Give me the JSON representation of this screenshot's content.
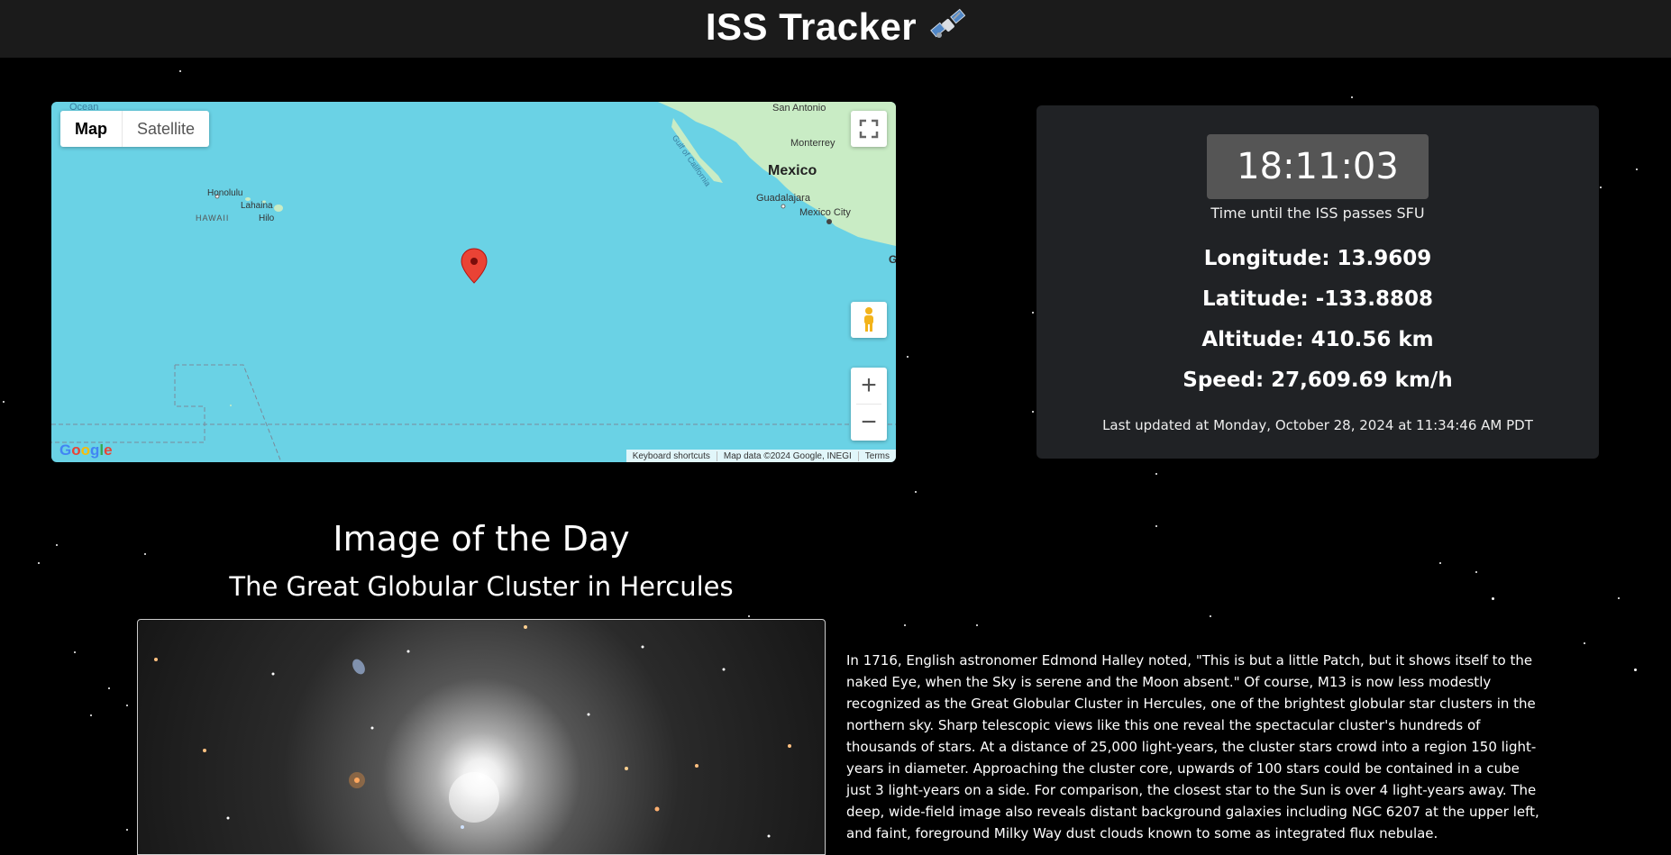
{
  "header": {
    "title": "ISS Tracker",
    "icon": "satellite-icon"
  },
  "map": {
    "type_control": {
      "map_label": "Map",
      "satellite_label": "Satellite",
      "selected": "Map"
    },
    "labels": {
      "ocean": "Ocean",
      "honolulu": "Honolulu",
      "lahaina": "Lahaina",
      "hawaii": "HAWAII",
      "hilo": "Hilo",
      "san_antonio": "San Antonio",
      "gulf": "Gulf of California",
      "monterrey": "Monterrey",
      "mexico": "Mexico",
      "guadalajara": "Guadalajara",
      "mexico_city": "Mexico City",
      "edge_g": "G"
    },
    "attribution": {
      "shortcuts": "Keyboard shortcuts",
      "data": "Map data ©2024 Google, INEGI",
      "terms": "Terms"
    },
    "logo": "Google"
  },
  "iss": {
    "countdown": "18:11:03",
    "countdown_caption": "Time until the ISS passes SFU",
    "longitude": "Longitude: 13.9609",
    "latitude": "Latitude: -133.8808",
    "altitude": "Altitude: 410.56 km",
    "speed": "Speed: 27,609.69 km/h",
    "last_updated": "Last updated at Monday, October 28, 2024 at 11:34:46 AM PDT"
  },
  "apod": {
    "heading": "Image of the Day",
    "title": "The Great Globular Cluster in Hercules",
    "description": "In 1716, English astronomer Edmond Halley noted, \"This is but a little Patch, but it shows itself to the naked Eye, when the Sky is serene and the Moon absent.\" Of course, M13 is now less modestly recognized as the Great Globular Cluster in Hercules, one of the brightest globular star clusters in the northern sky. Sharp telescopic views like this one reveal the spectacular cluster's hundreds of thousands of stars. At a distance of 25,000 light-years, the cluster stars crowd into a region 150 light-years in diameter. Approaching the cluster core, upwards of 100 stars could be contained in a cube just 3 light-years on a side. For comparison, the closest star to the Sun is over 4 light-years away. The deep, wide-field image also reveals distant background galaxies including NGC 6207 at the upper left, and faint, foreground Milky Way dust clouds known to some as integrated flux nebulae."
  },
  "colors": {
    "ocean": "#6ad2e5",
    "land": "#c9ecc5",
    "panel": "#202225",
    "timer_bg": "#555555",
    "header_bg": "#1b1b1b",
    "marker": "#ea4335"
  }
}
